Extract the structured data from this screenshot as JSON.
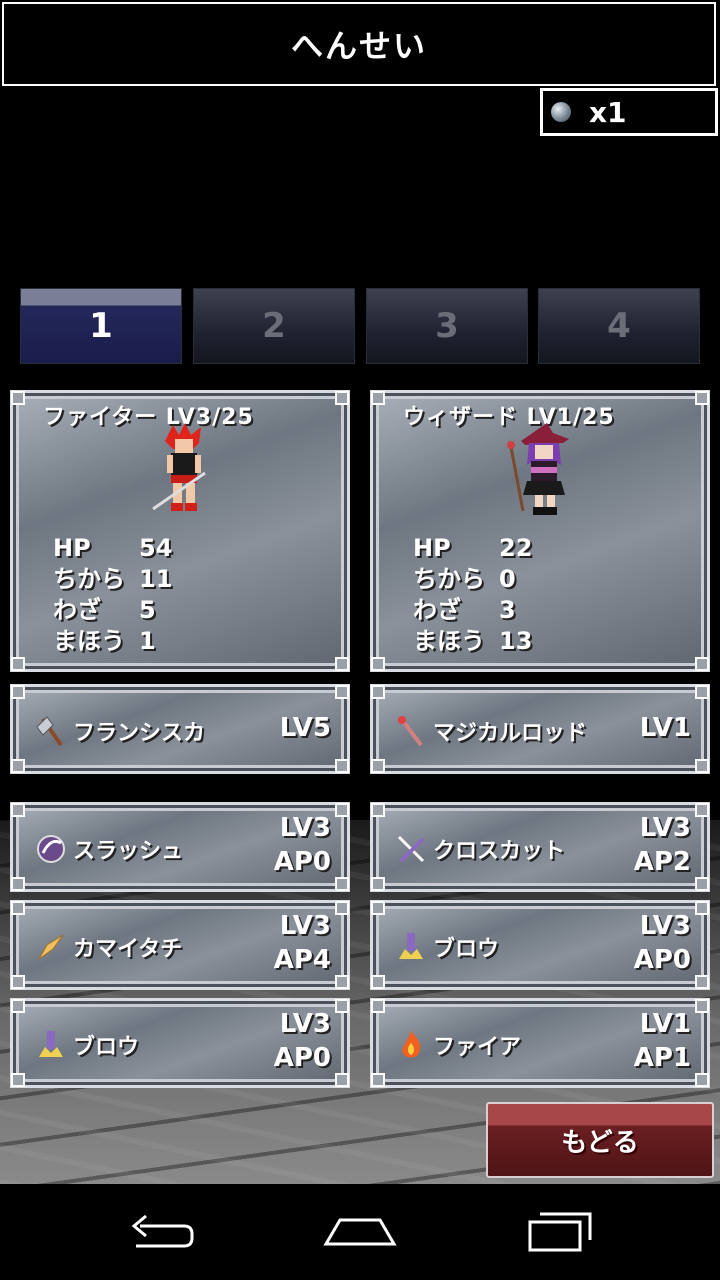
{
  "header": {
    "title": "へんせい"
  },
  "currency": {
    "icon": "gem-icon",
    "count": "x1"
  },
  "tabs": [
    {
      "label": "1",
      "active": true
    },
    {
      "label": "2",
      "active": false
    },
    {
      "label": "3",
      "active": false
    },
    {
      "label": "4",
      "active": false
    }
  ],
  "characters": [
    {
      "name": "ファイター LV3/25",
      "sprite": "fighter-sprite",
      "stats": [
        {
          "label": "HP",
          "value": "54"
        },
        {
          "label": "ちから",
          "value": "11"
        },
        {
          "label": "わざ",
          "value": "5"
        },
        {
          "label": "まほう",
          "value": "1"
        }
      ],
      "weapon": {
        "icon": "axe-icon",
        "name": "フランシスカ",
        "level": "LV5"
      },
      "skills": [
        {
          "icon": "slash-icon",
          "name": "スラッシュ",
          "level": "LV3",
          "ap": "AP0"
        },
        {
          "icon": "wind-blade-icon",
          "name": "カマイタチ",
          "level": "LV3",
          "ap": "AP4"
        },
        {
          "icon": "blow-icon",
          "name": "ブロウ",
          "level": "LV3",
          "ap": "AP0"
        }
      ]
    },
    {
      "name": "ウィザード LV1/25",
      "sprite": "wizard-sprite",
      "stats": [
        {
          "label": "HP",
          "value": "22"
        },
        {
          "label": "ちから",
          "value": "0"
        },
        {
          "label": "わざ",
          "value": "3"
        },
        {
          "label": "まほう",
          "value": "13"
        }
      ],
      "weapon": {
        "icon": "rod-icon",
        "name": "マジカルロッド",
        "level": "LV1"
      },
      "skills": [
        {
          "icon": "cross-cut-icon",
          "name": "クロスカット",
          "level": "LV3",
          "ap": "AP2"
        },
        {
          "icon": "blow-icon",
          "name": "ブロウ",
          "level": "LV3",
          "ap": "AP0"
        },
        {
          "icon": "fire-icon",
          "name": "ファイア",
          "level": "LV1",
          "ap": "AP1"
        }
      ]
    }
  ],
  "back_button": {
    "label": "もどる"
  },
  "navbar": {
    "back": "back-icon",
    "home": "home-icon",
    "recents": "recents-icon"
  },
  "colors": {
    "active_tab": "#23275a",
    "back_button": "#6b1f22",
    "panel": "#8a919b"
  }
}
